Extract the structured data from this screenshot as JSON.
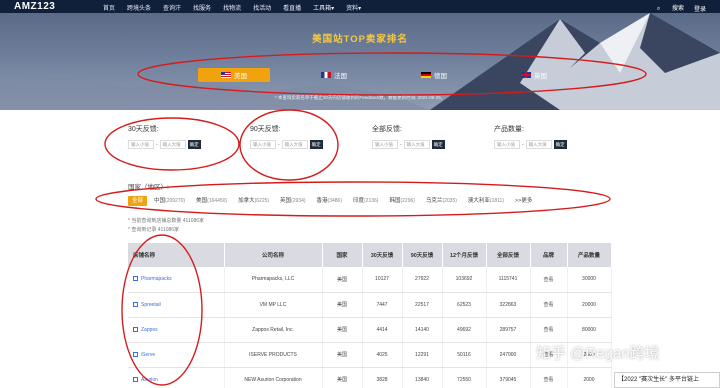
{
  "nav": {
    "logo": "AMZ123",
    "items": [
      "首页",
      "跨境头条",
      "查询汗",
      "找服务",
      "找物流",
      "找活动",
      "看直播",
      "工具箱▾",
      "资料▾"
    ],
    "search_label": "搜索",
    "login_label": "登录"
  },
  "hero": {
    "title": "美国站TOP卖家排名",
    "countries": [
      {
        "label": "美国",
        "flag": "us"
      },
      {
        "label": "法国",
        "flag": "fr"
      },
      {
        "label": "德国",
        "flag": "de"
      },
      {
        "label": "英国",
        "flag": "uk"
      }
    ],
    "note": "* 本查询卖家名单于截止30天内店铺收到的Feedback数。数据更新时间: 2021-09-29。"
  },
  "filters": [
    {
      "label": "30天反馈:",
      "min_placeholder": "输入小值",
      "max_placeholder": "输入大值",
      "confirm": "确定"
    },
    {
      "label": "90天反馈:",
      "min_placeholder": "输入小值",
      "max_placeholder": "输入大值",
      "confirm": "确定"
    },
    {
      "label": "全部反馈:",
      "min_placeholder": "输入小值",
      "max_placeholder": "输入大值",
      "confirm": "确定"
    },
    {
      "label": "产品数量:",
      "min_placeholder": "输入小值",
      "max_placeholder": "输入大值",
      "confirm": "确定"
    }
  ],
  "region": {
    "label": "国家（地区）:",
    "chips": [
      {
        "name": "全部",
        "count": ""
      },
      {
        "name": "中国",
        "count": "(209270)"
      },
      {
        "name": "美国",
        "count": "(164450)"
      },
      {
        "name": "加拿大",
        "count": "(6225)"
      },
      {
        "name": "英国",
        "count": "(2934)"
      },
      {
        "name": "香港",
        "count": "(3486)"
      },
      {
        "name": "印度",
        "count": "(2136)"
      },
      {
        "name": "韩国",
        "count": "(2296)"
      },
      {
        "name": "乌克兰",
        "count": "(2035)"
      },
      {
        "name": "澳大利亚",
        "count": "(1811)"
      },
      {
        "name": ">>更多",
        "count": ""
      }
    ],
    "records": [
      "* 当前查询到店铺总数量 411086家",
      "* 查询到记录 411086家"
    ]
  },
  "table": {
    "headers": [
      "店铺名称",
      "公司名称",
      "国家",
      "30天反馈",
      "90天反馈",
      "12个月反馈",
      "全部反馈",
      "品牌",
      "产品数量"
    ],
    "rows": [
      {
        "store": "Pharmapacks",
        "company": "Pharmapacks, LLC",
        "country": "美国",
        "d30": "10127",
        "d90": "27922",
        "m12": "103692",
        "all": "1115741",
        "brand": "查看",
        "products": "30000"
      },
      {
        "store": "Spreetail",
        "company": "VM MP LLC",
        "country": "美国",
        "d30": "7447",
        "d90": "22517",
        "m12": "62523",
        "all": "322863",
        "brand": "查看",
        "products": "20000"
      },
      {
        "store": "Zappos",
        "company": "Zappos Retail, Inc.",
        "country": "美国",
        "d30": "4414",
        "d90": "14140",
        "m12": "49692",
        "all": "289757",
        "brand": "查看",
        "products": "80000"
      },
      {
        "store": "iServe",
        "company": "ISERVE PRODUCTS",
        "country": "美国",
        "d30": "4025",
        "d90": "12291",
        "m12": "50116",
        "all": "247900",
        "brand": "查看",
        "products": "2000"
      },
      {
        "store": "Asurion",
        "company": "NEW Asurion Corporation",
        "country": "美国",
        "d30": "3828",
        "d90": "13840",
        "m12": "72550",
        "all": "379045",
        "brand": "查看",
        "products": "2000"
      }
    ]
  },
  "watermark": {
    "zhihu": "知乎 @Regan跨境",
    "banner": "【2022 \"赛次生长\" 多平台链上"
  },
  "colors": {
    "accent": "#f0a20f",
    "nav_bg": "#10203a",
    "annotation": "#d41c1c",
    "link": "#3a6fd8"
  }
}
